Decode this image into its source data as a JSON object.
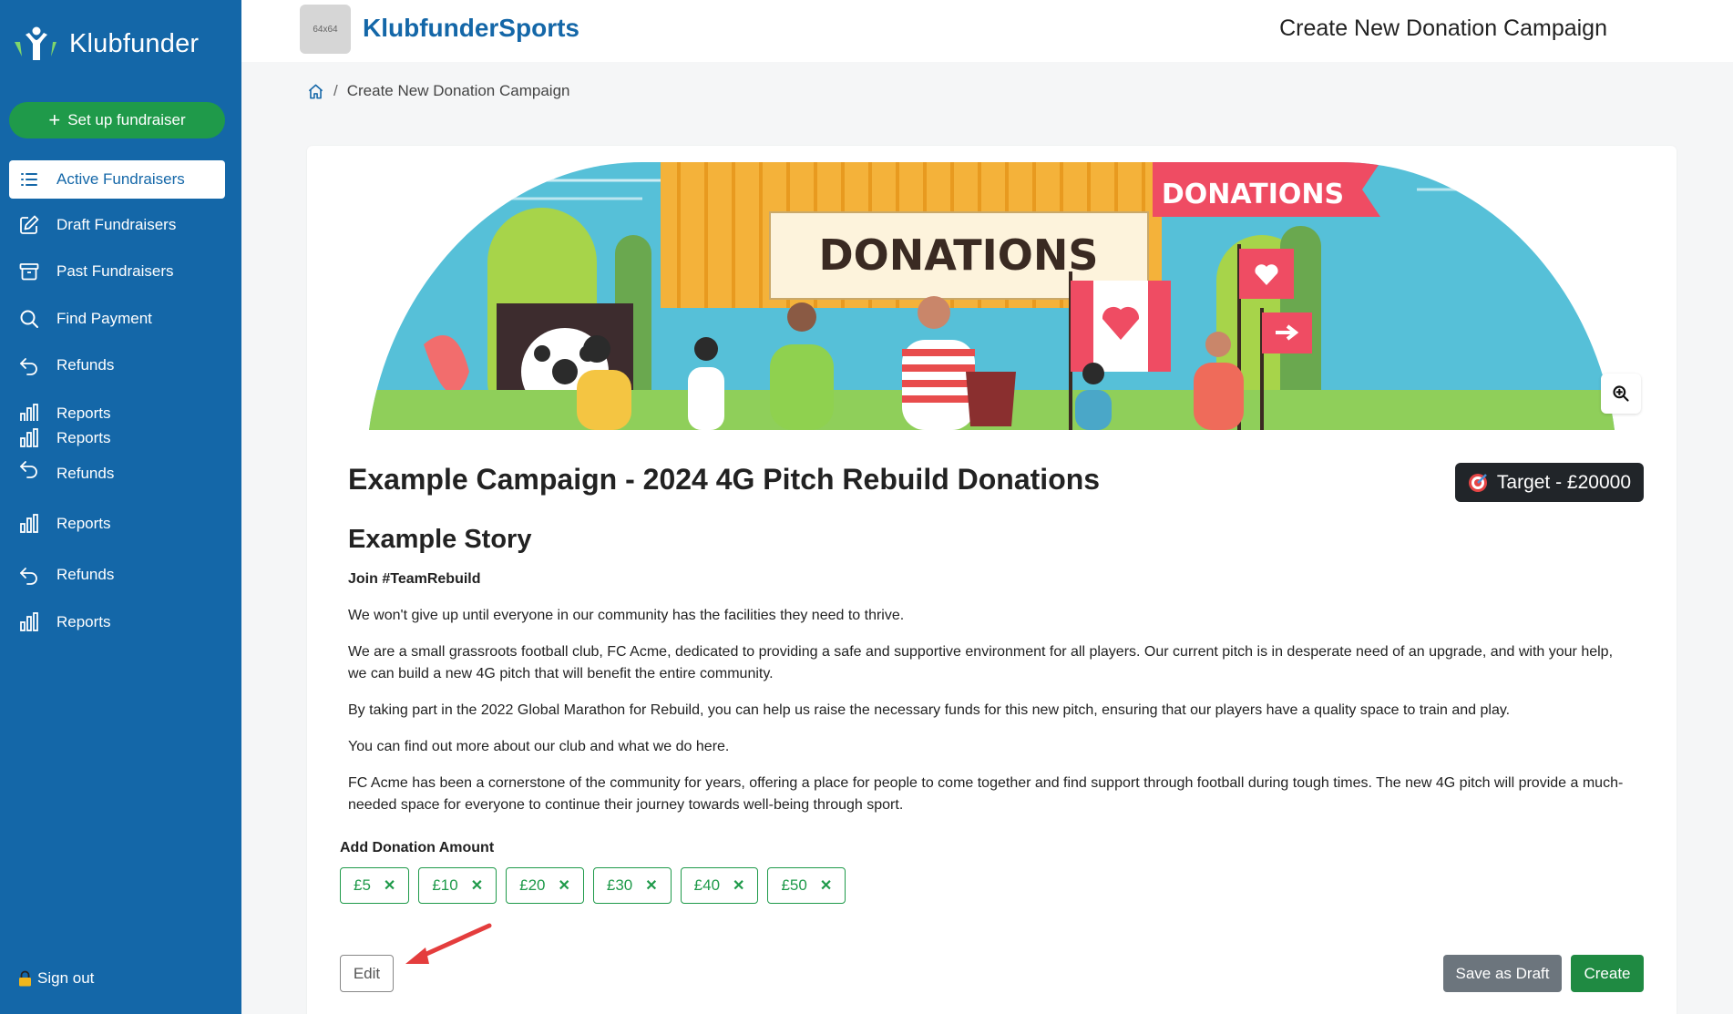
{
  "sidebar": {
    "brand": "Klubfunder",
    "setup_button": "Set up fundraiser",
    "items": [
      {
        "label": "Active Fundraisers",
        "icon": "list-icon"
      },
      {
        "label": "Draft Fundraisers",
        "icon": "edit-icon"
      },
      {
        "label": "Past Fundraisers",
        "icon": "archive-icon"
      },
      {
        "label": "Find Payment",
        "icon": "search-icon"
      },
      {
        "label": "Refunds",
        "icon": "undo-icon"
      },
      {
        "label": "Reports",
        "icon": "bar-chart-icon"
      },
      {
        "label": "Reports",
        "icon": "bar-chart-icon"
      },
      {
        "label": "Refunds",
        "icon": "undo-icon"
      },
      {
        "label": "Reports",
        "icon": "bar-chart-icon"
      },
      {
        "label": "Refunds",
        "icon": "undo-icon"
      },
      {
        "label": "Reports",
        "icon": "bar-chart-icon"
      }
    ],
    "signout": "Sign out"
  },
  "header": {
    "logo_placeholder": "64x64",
    "club_name": "KlubfunderSports",
    "title": "Create New Donation Campaign"
  },
  "breadcrumb": {
    "current": "Create New Donation Campaign"
  },
  "banner": {
    "sign_main": "DONATIONS",
    "sign_flag": "DONATIONS"
  },
  "campaign": {
    "title": "Example Campaign - 2024 4G Pitch Rebuild Donations",
    "target": "Target - £20000",
    "story_title": "Example Story",
    "tagline": "Join #TeamRebuild",
    "paragraphs": [
      "We won't give up until everyone in our community has the facilities they need to thrive.",
      "We are a small grassroots football club, FC Acme, dedicated to providing a safe and supportive environment for all players. Our current pitch is in desperate need of an upgrade, and with your help, we can build a new 4G pitch that will benefit the entire community.",
      "By taking part in the 2022 Global Marathon for Rebuild, you can help us raise the necessary funds for this new pitch, ensuring that our players have a quality space to train and play.",
      "You can find out more about our club and what we do here.",
      "FC Acme has been a cornerstone of the community for years, offering a place for people to come together and find support through football during tough times. The new 4G pitch will provide a much-needed space for everyone to continue their journey towards well-being through sport."
    ]
  },
  "donation": {
    "label": "Add Donation Amount",
    "amounts": [
      "£5",
      "£10",
      "£20",
      "£30",
      "£40",
      "£50"
    ]
  },
  "actions": {
    "edit": "Edit",
    "save_draft": "Save as Draft",
    "create": "Create"
  },
  "colors": {
    "sidebar": "#1467a8",
    "accent_green": "#1f9a4a",
    "dark_badge": "#212529",
    "secondary": "#6c757d"
  }
}
